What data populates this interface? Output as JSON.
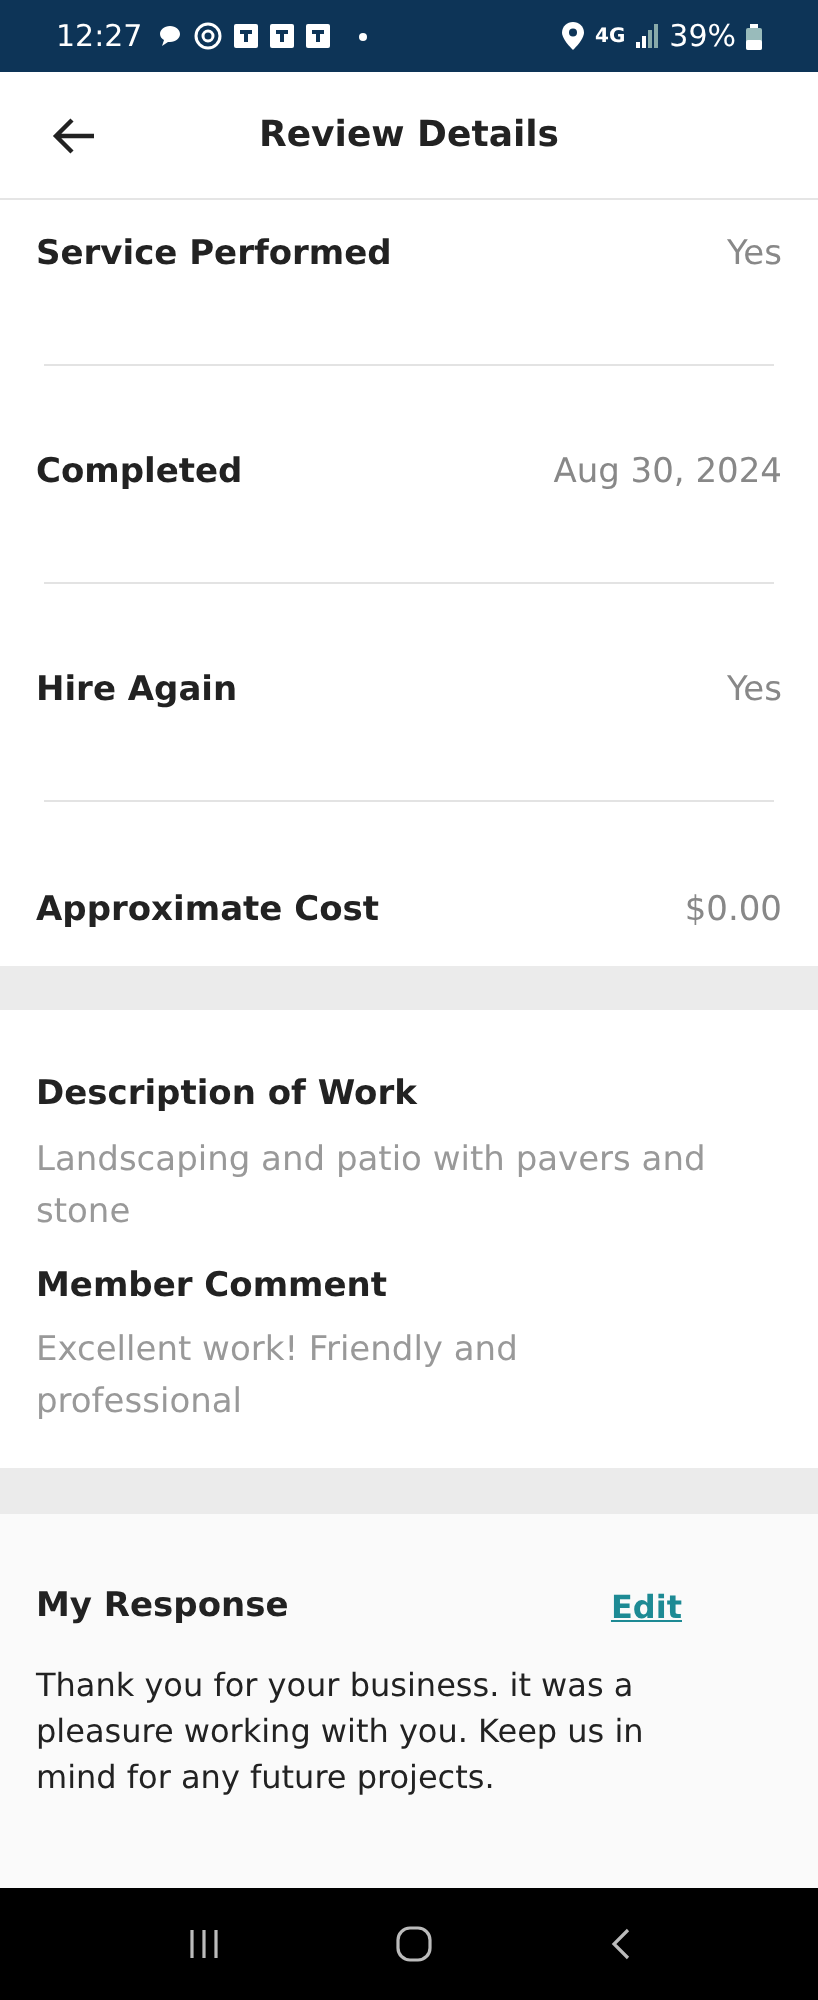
{
  "status_bar": {
    "time": "12:27",
    "network": "4G",
    "battery": "39%"
  },
  "header": {
    "title": "Review Details"
  },
  "details": [
    {
      "label": "Service Performed",
      "value": "Yes"
    },
    {
      "label": "Completed",
      "value": "Aug 30, 2024"
    },
    {
      "label": "Hire Again",
      "value": "Yes"
    },
    {
      "label": "Approximate Cost",
      "value": "$0.00"
    }
  ],
  "work": [
    {
      "label": "Description of Work",
      "text": "Landscaping and patio with pavers and stone"
    },
    {
      "label": "Member Comment",
      "text": "Excellent work! Friendly and professional"
    }
  ],
  "response": {
    "title": "My Response",
    "action": "Edit",
    "text": "Thank you for your business. it was a pleasure working with you. Keep us in mind for any future projects."
  }
}
